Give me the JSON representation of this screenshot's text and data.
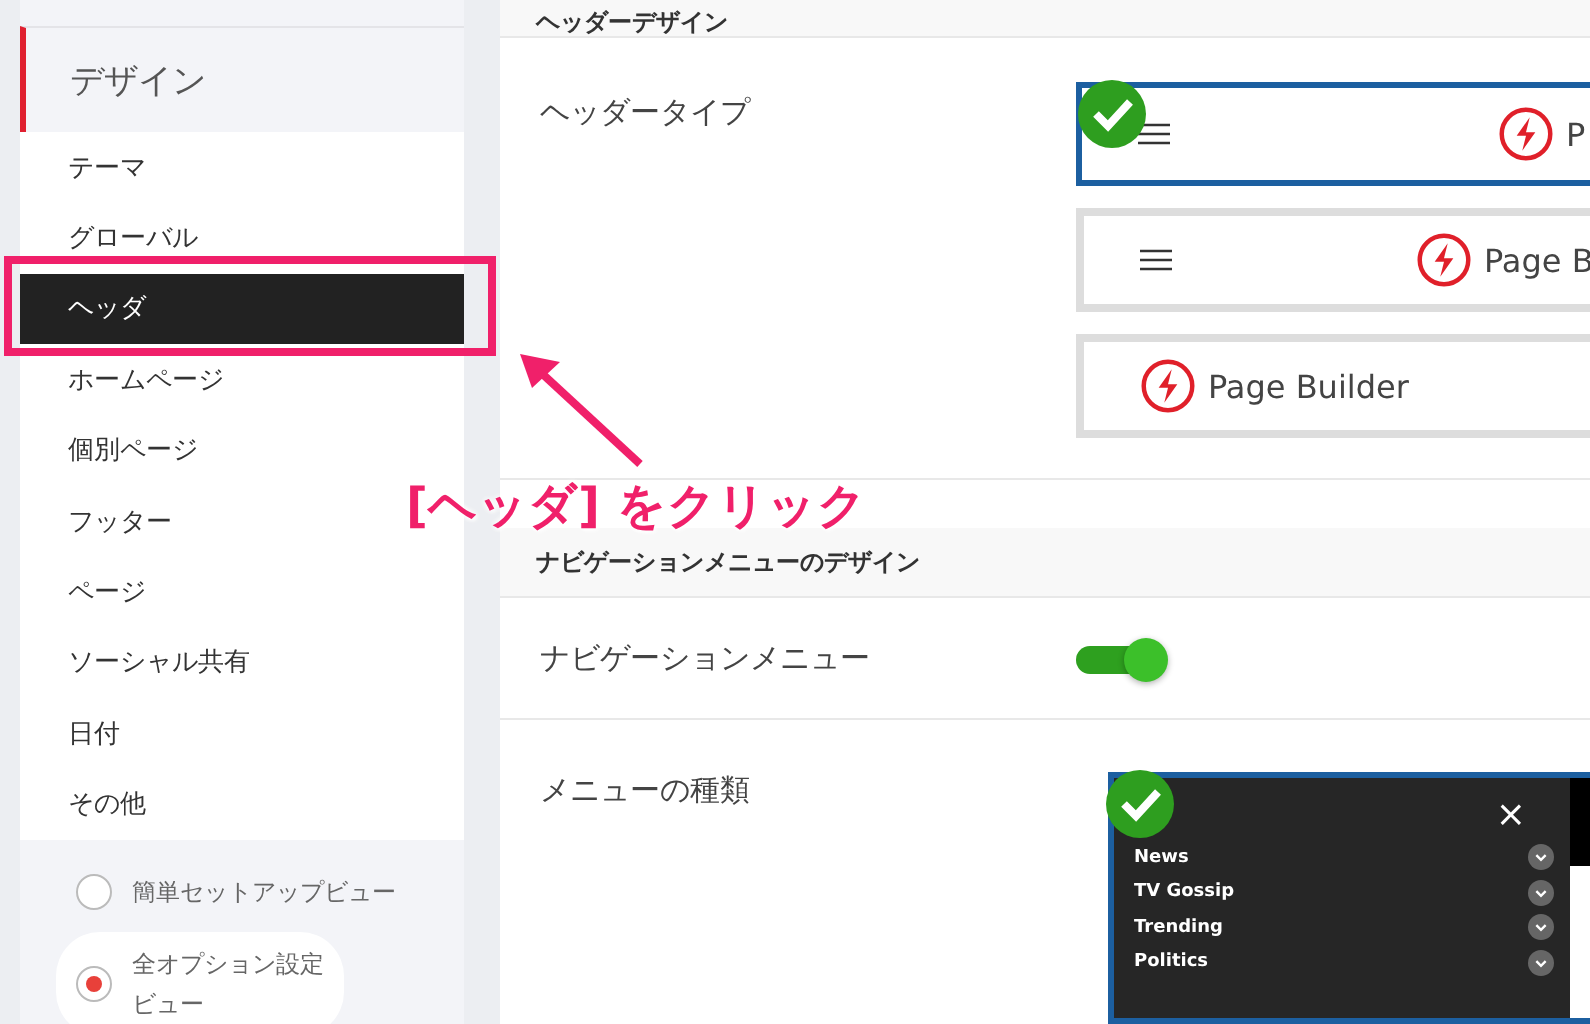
{
  "sidebar": {
    "section": "デザイン",
    "items": [
      {
        "label": "テーマ",
        "selected": false
      },
      {
        "label": "グローバル",
        "selected": false
      },
      {
        "label": "ヘッダ",
        "selected": true
      },
      {
        "label": "ホームページ",
        "selected": false
      },
      {
        "label": "個別ページ",
        "selected": false
      },
      {
        "label": "フッター",
        "selected": false
      },
      {
        "label": "ページ",
        "selected": false
      },
      {
        "label": "ソーシャル共有",
        "selected": false
      },
      {
        "label": "日付",
        "selected": false
      },
      {
        "label": "その他",
        "selected": false
      }
    ],
    "view_options": [
      {
        "label": "簡単セットアップビュー",
        "selected": false
      },
      {
        "label": "全オプション設定ビュー",
        "selected": true
      }
    ]
  },
  "sections": [
    {
      "title": "ヘッダーデザイン",
      "kind": "header",
      "label": "ヘッダータイプ",
      "options": [
        {
          "text": "P",
          "menu_icon": true,
          "selected": true
        },
        {
          "text": "Page B",
          "menu_icon": true,
          "selected": false
        },
        {
          "text": "Page Builder",
          "menu_icon": false,
          "selected": false
        }
      ]
    },
    {
      "title": "ナビゲーションメニューのデザイン",
      "kind": "nav",
      "toggle_label": "ナビゲーションメニュー",
      "on": true,
      "menu_label": "メニューの種類",
      "menu_preview": {
        "selected": true,
        "close": "×",
        "items": [
          "News",
          "TV Gossip",
          "Trending",
          "Politics"
        ]
      }
    }
  ],
  "annotation": {
    "text": "[ヘッダ] をクリック"
  }
}
